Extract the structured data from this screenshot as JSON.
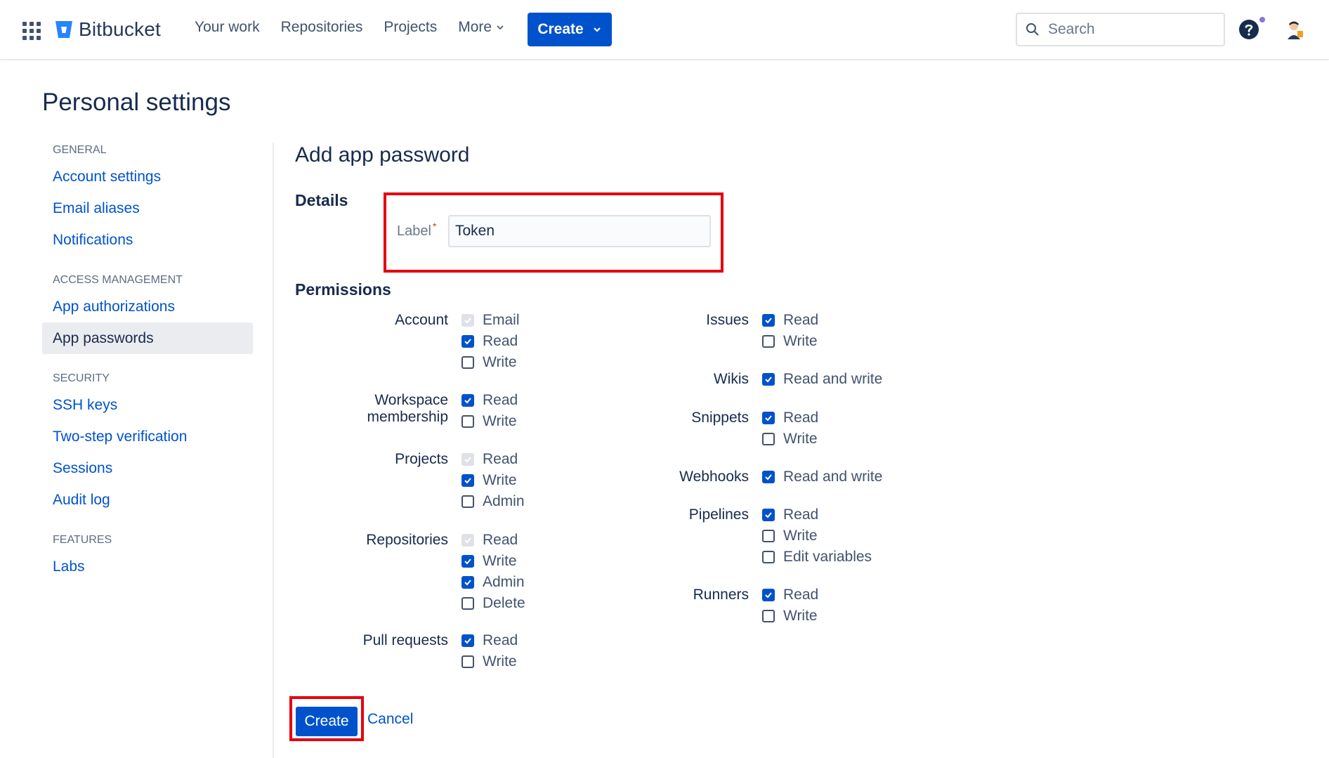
{
  "topbar": {
    "product": "Bitbucket",
    "nav": [
      "Your work",
      "Repositories",
      "Projects",
      "More"
    ],
    "create_label": "Create",
    "search_placeholder": "Search"
  },
  "page_title": "Personal settings",
  "sidebar": {
    "groups": [
      {
        "heading": "GENERAL",
        "items": [
          "Account settings",
          "Email aliases",
          "Notifications"
        ]
      },
      {
        "heading": "ACCESS MANAGEMENT",
        "items": [
          "App authorizations",
          "App passwords"
        ]
      },
      {
        "heading": "SECURITY",
        "items": [
          "SSH keys",
          "Two-step verification",
          "Sessions",
          "Audit log"
        ]
      },
      {
        "heading": "FEATURES",
        "items": [
          "Labs"
        ]
      }
    ],
    "active": "App passwords"
  },
  "main": {
    "title": "Add app password",
    "details_heading": "Details",
    "label_field": {
      "label": "Label",
      "required_mark": "*",
      "value": "Token"
    },
    "permissions_heading": "Permissions",
    "permissions_left": [
      {
        "name": "Account",
        "options": [
          {
            "label": "Email",
            "checked": true,
            "disabled": true
          },
          {
            "label": "Read",
            "checked": true
          },
          {
            "label": "Write",
            "checked": false
          }
        ]
      },
      {
        "name": "Workspace membership",
        "options": [
          {
            "label": "Read",
            "checked": true
          },
          {
            "label": "Write",
            "checked": false
          }
        ]
      },
      {
        "name": "Projects",
        "options": [
          {
            "label": "Read",
            "checked": true,
            "disabled": true
          },
          {
            "label": "Write",
            "checked": true
          },
          {
            "label": "Admin",
            "checked": false
          }
        ]
      },
      {
        "name": "Repositories",
        "options": [
          {
            "label": "Read",
            "checked": true,
            "disabled": true
          },
          {
            "label": "Write",
            "checked": true
          },
          {
            "label": "Admin",
            "checked": true
          },
          {
            "label": "Delete",
            "checked": false
          }
        ]
      },
      {
        "name": "Pull requests",
        "options": [
          {
            "label": "Read",
            "checked": true
          },
          {
            "label": "Write",
            "checked": false
          }
        ]
      }
    ],
    "permissions_right": [
      {
        "name": "Issues",
        "options": [
          {
            "label": "Read",
            "checked": true
          },
          {
            "label": "Write",
            "checked": false
          }
        ]
      },
      {
        "name": "Wikis",
        "options": [
          {
            "label": "Read and write",
            "checked": true
          }
        ]
      },
      {
        "name": "Snippets",
        "options": [
          {
            "label": "Read",
            "checked": true
          },
          {
            "label": "Write",
            "checked": false
          }
        ]
      },
      {
        "name": "Webhooks",
        "options": [
          {
            "label": "Read and write",
            "checked": true
          }
        ]
      },
      {
        "name": "Pipelines",
        "options": [
          {
            "label": "Read",
            "checked": true
          },
          {
            "label": "Write",
            "checked": false
          },
          {
            "label": "Edit variables",
            "checked": false
          }
        ]
      },
      {
        "name": "Runners",
        "options": [
          {
            "label": "Read",
            "checked": true
          },
          {
            "label": "Write",
            "checked": false
          }
        ]
      }
    ],
    "submit_label": "Create",
    "cancel_label": "Cancel"
  },
  "colors": {
    "primary": "#0052cc",
    "highlight": "#e4000f",
    "text": "#172b4d"
  }
}
